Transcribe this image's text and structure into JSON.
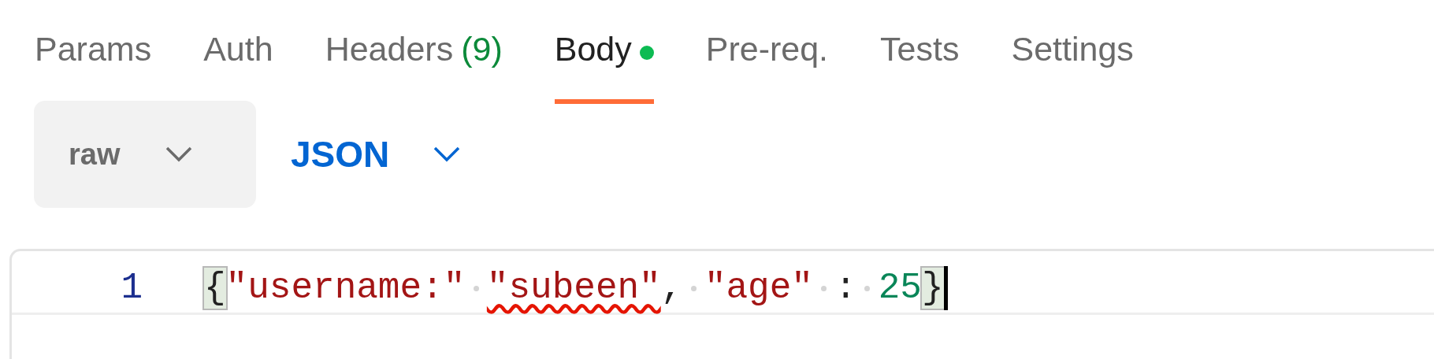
{
  "tabs": [
    {
      "label": "Params",
      "selected": false
    },
    {
      "label": "Auth",
      "selected": false
    },
    {
      "label": "Headers",
      "count": "(9)",
      "selected": false
    },
    {
      "label": "Body",
      "selected": true,
      "modified": true
    },
    {
      "label": "Pre-req.",
      "selected": false
    },
    {
      "label": "Tests",
      "selected": false
    },
    {
      "label": "Settings",
      "selected": false
    }
  ],
  "body_mode": {
    "value": "raw"
  },
  "language": {
    "value": "JSON"
  },
  "editor": {
    "lines": [
      {
        "number": "1",
        "tokens": [
          {
            "kind": "brace",
            "text": "{",
            "highlighted": true,
            "error": false
          },
          {
            "kind": "string",
            "text": "\"username:\"",
            "highlighted": false,
            "error": false
          },
          {
            "kind": "space"
          },
          {
            "kind": "string",
            "text": "\"subeen\"",
            "highlighted": false,
            "error": true
          },
          {
            "kind": "punct",
            "text": ",",
            "highlighted": false,
            "error": false
          },
          {
            "kind": "space"
          },
          {
            "kind": "string",
            "text": "\"age\"",
            "highlighted": false,
            "error": false
          },
          {
            "kind": "space"
          },
          {
            "kind": "punct",
            "text": ":",
            "highlighted": false,
            "error": false
          },
          {
            "kind": "space"
          },
          {
            "kind": "number",
            "text": "25",
            "highlighted": false,
            "error": false
          },
          {
            "kind": "brace",
            "text": "}",
            "highlighted": true,
            "error": false
          }
        ],
        "cursor": true
      }
    ]
  }
}
